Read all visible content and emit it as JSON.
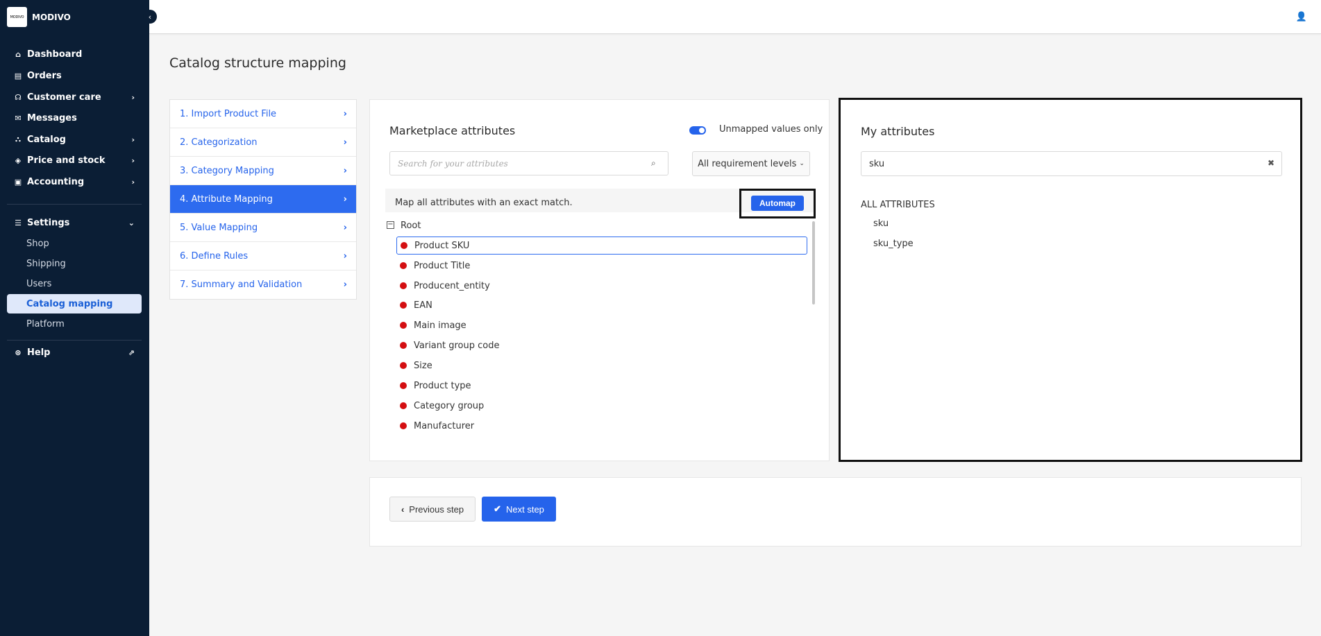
{
  "brand": {
    "logo_text": "MODIVO",
    "name": "MODIVO"
  },
  "sidebar": {
    "collapse_icon": "‹",
    "items": [
      {
        "label": "Dashboard",
        "icon": "⌂"
      },
      {
        "label": "Orders",
        "icon": "▤"
      },
      {
        "label": "Customer care",
        "icon": "☊"
      },
      {
        "label": "Messages",
        "icon": "✉"
      },
      {
        "label": "Catalog",
        "icon": "⛬"
      },
      {
        "label": "Price and stock",
        "icon": "◈"
      },
      {
        "label": "Accounting",
        "icon": "▣"
      },
      {
        "label": "Settings",
        "icon": "☰"
      },
      {
        "label": "Help",
        "icon": "⊛"
      }
    ],
    "settings_sub": [
      "Shop",
      "Shipping",
      "Users",
      "Catalog mapping",
      "Platform"
    ],
    "chevron": "›",
    "chevron_down": "⌄",
    "external_icon": "⇗"
  },
  "topbar": {
    "user_icon": "👤"
  },
  "page": {
    "title": "Catalog structure mapping"
  },
  "steps": [
    "1. Import Product File",
    "2. Categorization",
    "3. Category Mapping",
    "4. Attribute Mapping",
    "5. Value Mapping",
    "6. Define Rules",
    "7. Summary and Validation"
  ],
  "step_chevron": "›",
  "marketplace": {
    "title": "Marketplace attributes",
    "toggle_label": "Unmapped values only",
    "search_placeholder": "Search for your attributes",
    "search_icon": "⌕",
    "requirement_dropdown": "All requirement levels",
    "dropdown_chevron": "⌄",
    "automap_text": "Map all attributes with an exact match.",
    "automap_button": "Automap",
    "tree_toggle": "−",
    "tree_root": "Root",
    "attributes": [
      "Product SKU",
      "Product Title",
      "Producent_entity",
      "EAN",
      "Main image",
      "Variant group code",
      "Size",
      "Product type",
      "Category group",
      "Manufacturer"
    ]
  },
  "my_attributes": {
    "title": "My attributes",
    "search_value": "sku",
    "clear_icon": "✖",
    "section_label": "ALL ATTRIBUTES",
    "items": [
      "sku",
      "sku_type"
    ]
  },
  "footer_nav": {
    "prev_label": "Previous step",
    "prev_icon": "‹",
    "next_label": "Next step",
    "next_icon": "✔"
  },
  "colors": {
    "sidebar_bg": "#0b1e35",
    "accent": "#2563eb",
    "status_red": "#d40f12"
  }
}
